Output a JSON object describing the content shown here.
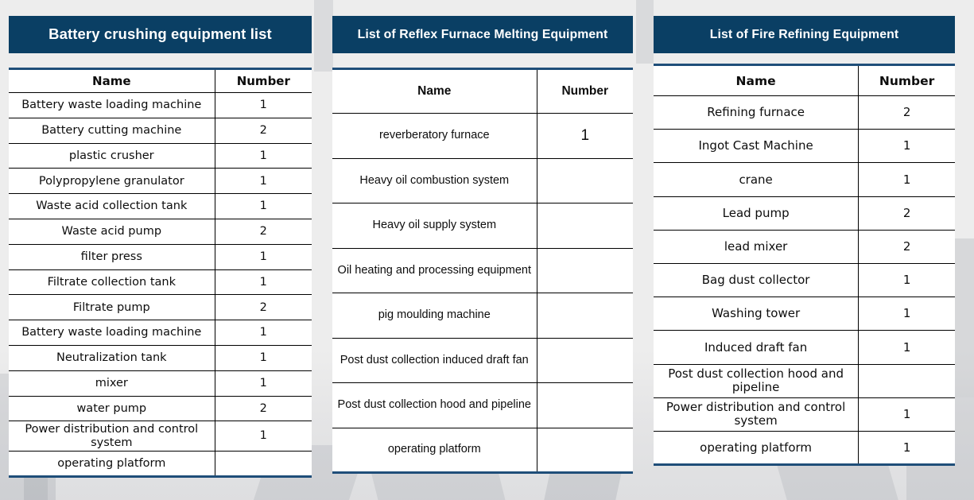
{
  "background": {
    "page_color": "#ededed",
    "accent_color": "#0a3f64",
    "table_border_color": "#1f4e79",
    "grid_line_color": "#000000",
    "title_text_color": "#ffffff"
  },
  "tables": [
    {
      "id": "battery-crushing",
      "title": "Battery crushing equipment list",
      "columns": [
        "Name",
        "Number"
      ],
      "rows": [
        {
          "name": "Battery waste loading machine",
          "number": "1"
        },
        {
          "name": "Battery cutting machine",
          "number": "2"
        },
        {
          "name": "plastic crusher",
          "number": "1"
        },
        {
          "name": "Polypropylene granulator",
          "number": "1"
        },
        {
          "name": "Waste acid collection tank",
          "number": "1"
        },
        {
          "name": "Waste acid pump",
          "number": "2"
        },
        {
          "name": "filter press",
          "number": "1"
        },
        {
          "name": "Filtrate collection tank",
          "number": "1"
        },
        {
          "name": "Filtrate pump",
          "number": "2"
        },
        {
          "name": "Battery waste loading machine",
          "number": "1"
        },
        {
          "name": "Neutralization tank",
          "number": "1"
        },
        {
          "name": "mixer",
          "number": "1"
        },
        {
          "name": "water pump",
          "number": "2"
        },
        {
          "name": "Power distribution and control system",
          "number": "1"
        },
        {
          "name": "operating platform",
          "number": ""
        }
      ]
    },
    {
      "id": "reflex-furnace-melting",
      "title": "List of Reflex Furnace Melting Equipment",
      "columns": [
        "Name",
        "Number"
      ],
      "rows": [
        {
          "name": "reverberatory  furnace",
          "number": "1"
        },
        {
          "name": "Heavy oil combustion system",
          "number": ""
        },
        {
          "name": "Heavy oil supply system",
          "number": ""
        },
        {
          "name": "Oil heating and processing equipment",
          "number": ""
        },
        {
          "name": "pig moulding machine",
          "number": ""
        },
        {
          "name": "Post dust collection induced draft fan",
          "number": ""
        },
        {
          "name": "Post dust collection hood and pipeline",
          "number": ""
        },
        {
          "name": "operating platform",
          "number": ""
        }
      ]
    },
    {
      "id": "fire-refining",
      "title": "List of Fire Refining Equipment",
      "columns": [
        "Name",
        "Number"
      ],
      "rows": [
        {
          "name": "Refining furnace",
          "number": "2"
        },
        {
          "name": "Ingot Cast Machine",
          "number": "1"
        },
        {
          "name": "crane",
          "number": "1"
        },
        {
          "name": "Lead pump",
          "number": "2"
        },
        {
          "name": "lead mixer",
          "number": "2"
        },
        {
          "name": "Bag dust collector",
          "number": "1"
        },
        {
          "name": "Washing tower",
          "number": "1"
        },
        {
          "name": "Induced draft fan",
          "number": "1"
        },
        {
          "name": "Post dust collection hood and pipeline",
          "number": ""
        },
        {
          "name": "Power distribution and control system",
          "number": "1"
        },
        {
          "name": "operating platform",
          "number": "1"
        }
      ]
    }
  ]
}
